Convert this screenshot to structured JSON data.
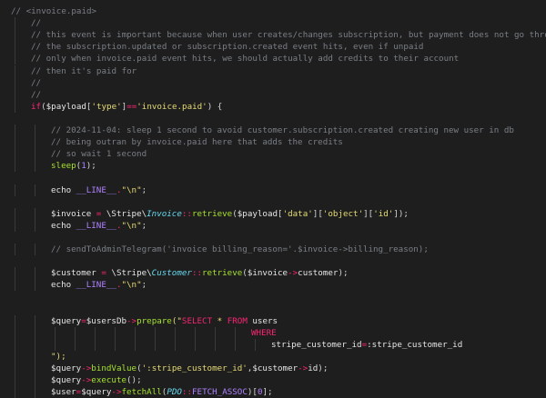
{
  "editor": {
    "language": "php",
    "colors": {
      "background": "#1e1e1e",
      "comment": "#7a7f86",
      "keyword": "#f92672",
      "string": "#e6db74",
      "function": "#a6e22e",
      "class": "#66d9ef",
      "constant": "#ae81ff"
    },
    "lines": [
      {
        "indent": 0,
        "tokens": [
          {
            "t": "// <invoice.paid>",
            "c": "c"
          }
        ]
      },
      {
        "indent": 1,
        "tokens": [
          {
            "t": "//",
            "c": "c"
          }
        ]
      },
      {
        "indent": 1,
        "tokens": [
          {
            "t": "// this event is important because when user creates/changes subscription, but payment does not go through",
            "c": "c"
          }
        ]
      },
      {
        "indent": 1,
        "tokens": [
          {
            "t": "// the subscription.updated or subscription.created event hits, even if unpaid",
            "c": "c"
          }
        ]
      },
      {
        "indent": 1,
        "tokens": [
          {
            "t": "// only when invoice.paid event hits, we should actually add credits to their account",
            "c": "c"
          }
        ]
      },
      {
        "indent": 1,
        "tokens": [
          {
            "t": "// then it's paid for",
            "c": "c"
          }
        ]
      },
      {
        "indent": 1,
        "tokens": [
          {
            "t": "//",
            "c": "c"
          }
        ]
      },
      {
        "indent": 1,
        "tokens": [
          {
            "t": "//",
            "c": "c"
          }
        ]
      },
      {
        "indent": 1,
        "tokens": [
          {
            "t": "if",
            "c": "kw"
          },
          {
            "t": "(",
            "c": "p"
          },
          {
            "t": "$payload",
            "c": "v"
          },
          {
            "t": "[",
            "c": "p"
          },
          {
            "t": "'type'",
            "c": "s"
          },
          {
            "t": "]",
            "c": "p"
          },
          {
            "t": "==",
            "c": "kw"
          },
          {
            "t": "'invoice.paid'",
            "c": "s"
          },
          {
            "t": ") {",
            "c": "p"
          }
        ]
      },
      {
        "indent": 0,
        "tokens": []
      },
      {
        "indent": 2,
        "tokens": [
          {
            "t": "// 2024-11-04: sleep 1 second to avoid customer.subscription.created creating new user in db",
            "c": "c"
          }
        ]
      },
      {
        "indent": 2,
        "tokens": [
          {
            "t": "// being outran by invoice.paid here that adds the credits",
            "c": "c"
          }
        ]
      },
      {
        "indent": 2,
        "tokens": [
          {
            "t": "// so wait 1 second",
            "c": "c"
          }
        ]
      },
      {
        "indent": 2,
        "tokens": [
          {
            "t": "sleep",
            "c": "fn"
          },
          {
            "t": "(",
            "c": "p"
          },
          {
            "t": "1",
            "c": "cst"
          },
          {
            "t": ");",
            "c": "p"
          }
        ]
      },
      {
        "indent": 0,
        "tokens": []
      },
      {
        "indent": 2,
        "tokens": [
          {
            "t": "echo ",
            "c": "v"
          },
          {
            "t": "__LINE__",
            "c": "cst"
          },
          {
            "t": ".",
            "c": "kw"
          },
          {
            "t": "\"\\n\"",
            "c": "s"
          },
          {
            "t": ";",
            "c": "p"
          }
        ]
      },
      {
        "indent": 0,
        "tokens": []
      },
      {
        "indent": 2,
        "tokens": [
          {
            "t": "$invoice",
            "c": "v"
          },
          {
            "t": " = ",
            "c": "kw"
          },
          {
            "t": "\\Stripe\\",
            "c": "v"
          },
          {
            "t": "Invoice",
            "c": "ty"
          },
          {
            "t": "::",
            "c": "kw"
          },
          {
            "t": "retrieve",
            "c": "fn"
          },
          {
            "t": "(",
            "c": "p"
          },
          {
            "t": "$payload",
            "c": "v"
          },
          {
            "t": "[",
            "c": "p"
          },
          {
            "t": "'data'",
            "c": "s"
          },
          {
            "t": "][",
            "c": "p"
          },
          {
            "t": "'object'",
            "c": "s"
          },
          {
            "t": "][",
            "c": "p"
          },
          {
            "t": "'id'",
            "c": "s"
          },
          {
            "t": "]);",
            "c": "p"
          }
        ]
      },
      {
        "indent": 2,
        "tokens": [
          {
            "t": "echo ",
            "c": "v"
          },
          {
            "t": "__LINE__",
            "c": "cst"
          },
          {
            "t": ".",
            "c": "kw"
          },
          {
            "t": "\"\\n\"",
            "c": "s"
          },
          {
            "t": ";",
            "c": "p"
          }
        ]
      },
      {
        "indent": 0,
        "tokens": []
      },
      {
        "indent": 2,
        "tokens": [
          {
            "t": "// sendToAdminTelegram('invoice billing_reason='.$invoice->billing_reason);",
            "c": "c"
          }
        ]
      },
      {
        "indent": 0,
        "tokens": []
      },
      {
        "indent": 2,
        "tokens": [
          {
            "t": "$customer",
            "c": "v"
          },
          {
            "t": " = ",
            "c": "kw"
          },
          {
            "t": "\\Stripe\\",
            "c": "v"
          },
          {
            "t": "Customer",
            "c": "ty"
          },
          {
            "t": "::",
            "c": "kw"
          },
          {
            "t": "retrieve",
            "c": "fn"
          },
          {
            "t": "(",
            "c": "p"
          },
          {
            "t": "$invoice",
            "c": "v"
          },
          {
            "t": "->",
            "c": "kw"
          },
          {
            "t": "customer",
            "c": "v"
          },
          {
            "t": ");",
            "c": "p"
          }
        ]
      },
      {
        "indent": 2,
        "tokens": [
          {
            "t": "echo ",
            "c": "v"
          },
          {
            "t": "__LINE__",
            "c": "cst"
          },
          {
            "t": ".",
            "c": "kw"
          },
          {
            "t": "\"\\n\"",
            "c": "s"
          },
          {
            "t": ";",
            "c": "p"
          }
        ]
      },
      {
        "indent": 0,
        "tokens": []
      },
      {
        "indent": 0,
        "tokens": []
      },
      {
        "indent": 2,
        "tokens": [
          {
            "t": "$query",
            "c": "v"
          },
          {
            "t": "=",
            "c": "kw"
          },
          {
            "t": "$usersDb",
            "c": "v"
          },
          {
            "t": "->",
            "c": "kw"
          },
          {
            "t": "prepare",
            "c": "fn"
          },
          {
            "t": "(\"",
            "c": "s"
          },
          {
            "t": "SELECT",
            "c": "kw"
          },
          {
            "t": " * ",
            "c": "s"
          },
          {
            "t": "FROM",
            "c": "kw"
          },
          {
            "t": " users",
            "c": "v"
          }
        ]
      },
      {
        "indent": 12,
        "tokens": [
          {
            "t": "WHERE",
            "c": "kw"
          }
        ]
      },
      {
        "indent": 13,
        "tokens": [
          {
            "t": "stripe_customer_id",
            "c": "v"
          },
          {
            "t": "=",
            "c": "kw"
          },
          {
            "t": ":stripe_customer_id",
            "c": "v"
          }
        ]
      },
      {
        "indent": 2,
        "tokens": [
          {
            "t": "\");",
            "c": "s"
          }
        ]
      },
      {
        "indent": 2,
        "tokens": [
          {
            "t": "$query",
            "c": "v"
          },
          {
            "t": "->",
            "c": "kw"
          },
          {
            "t": "bindValue",
            "c": "fn"
          },
          {
            "t": "(",
            "c": "p"
          },
          {
            "t": "':stripe_customer_id'",
            "c": "s"
          },
          {
            "t": ",",
            "c": "p"
          },
          {
            "t": "$customer",
            "c": "v"
          },
          {
            "t": "->",
            "c": "kw"
          },
          {
            "t": "id",
            "c": "v"
          },
          {
            "t": ");",
            "c": "p"
          }
        ]
      },
      {
        "indent": 2,
        "tokens": [
          {
            "t": "$query",
            "c": "v"
          },
          {
            "t": "->",
            "c": "kw"
          },
          {
            "t": "execute",
            "c": "fn"
          },
          {
            "t": "();",
            "c": "p"
          }
        ]
      },
      {
        "indent": 2,
        "tokens": [
          {
            "t": "$user",
            "c": "v"
          },
          {
            "t": "=",
            "c": "kw"
          },
          {
            "t": "$query",
            "c": "v"
          },
          {
            "t": "->",
            "c": "kw"
          },
          {
            "t": "fetchAll",
            "c": "fn"
          },
          {
            "t": "(",
            "c": "p"
          },
          {
            "t": "PDO",
            "c": "ty"
          },
          {
            "t": "::",
            "c": "kw"
          },
          {
            "t": "FETCH_ASSOC",
            "c": "cst"
          },
          {
            "t": ")[",
            "c": "p"
          },
          {
            "t": "0",
            "c": "cst"
          },
          {
            "t": "];",
            "c": "p"
          }
        ]
      }
    ]
  }
}
